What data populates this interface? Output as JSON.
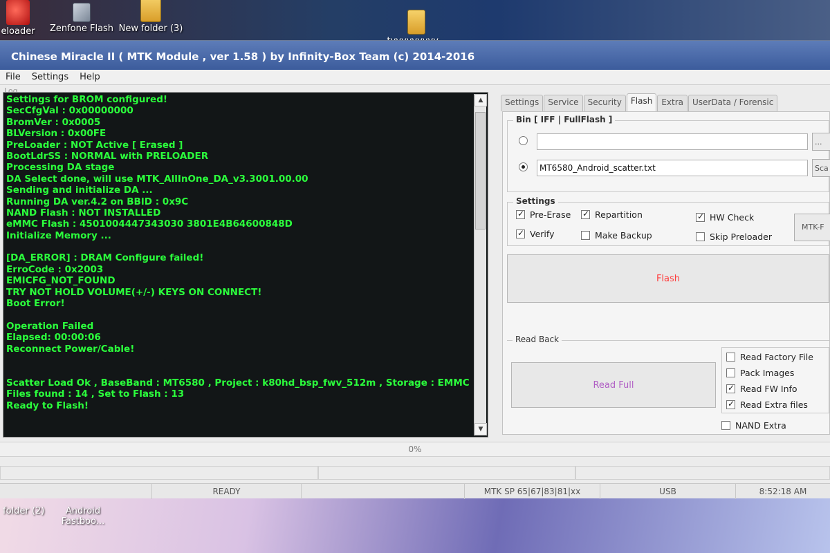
{
  "desktop": {
    "top_icons": [
      {
        "label": "eloader",
        "kind": "red"
      },
      {
        "label": "Zenfone Flash",
        "kind": "app"
      },
      {
        "label": "New folder (3)",
        "kind": "folder"
      },
      {
        "label": "tyyyyyyyyy...",
        "kind": "folder"
      }
    ],
    "bottom_icons": [
      {
        "label": "folder (2)"
      },
      {
        "label": "Android Fastboo..."
      }
    ]
  },
  "window": {
    "title": "Chinese Miracle II ( MTK Module , ver 1.58 ) by Infinity-Box Team (c) 2014-2016",
    "menu": [
      "File",
      "Settings",
      "Help"
    ],
    "log_label": "Log"
  },
  "log": {
    "lines": [
      "Settings for BROM configured!",
      "SecCfgVal : 0x00000000",
      "BromVer   : 0x0005",
      "BLVersion : 0x00FE",
      "PreLoader : NOT Active [ Erased ]",
      "BootLdrSS : NORMAL with PRELOADER",
      "Processing DA stage",
      "DA Select done, will use MTK_AllInOne_DA_v3.3001.00.00",
      "Sending and initialize DA ...",
      "Running DA ver.4.2 on BBID : 0x9C",
      "NAND Flash : NOT INSTALLED",
      "eMMC Flash : 4501004447343030 3801E4B64600848D",
      "Initialize Memory ...",
      "",
      "[DA_ERROR] : DRAM Configure failed!",
      "ErroCode : 0x2003",
      "EMICFG_NOT_FOUND",
      "TRY NOT HOLD VOLUME(+/-) KEYS ON CONNECT!",
      "Boot Error!",
      "",
      "Operation Failed",
      "Elapsed: 00:00:06",
      "Reconnect Power/Cable!",
      "",
      "",
      "Scatter Load Ok , BaseBand : MT6580 , Project : k80hd_bsp_fwv_512m , Storage : EMMC",
      "Files found : 14 , Set to Flash : 13",
      "Ready to Flash!"
    ]
  },
  "tabs": [
    "Settings",
    "Service",
    "Security",
    "Flash",
    "Extra",
    "UserData / Forensic"
  ],
  "active_tab": "Flash",
  "bin": {
    "title": "Bin  [ IFF | FullFlash ]",
    "path1": "",
    "path2": "MT6580_Android_scatter.txt",
    "button1": "...",
    "button2": "Sca"
  },
  "settings": {
    "title": "Settings",
    "pre_erase": "Pre-Erase",
    "repartition": "Repartition",
    "hw_check": "HW Check",
    "verify": "Verify",
    "make_backup": "Make Backup",
    "skip_preloader": "Skip Preloader",
    "mtk_button": "MTK-F"
  },
  "flash_button": "Flash",
  "read_back": {
    "title": "Read Back",
    "read_full": "Read Full",
    "read_factory": "Read Factory File",
    "pack_images": "Pack Images",
    "read_fw_info": "Read FW Info",
    "read_extra": "Read Extra files",
    "nand_extra": "NAND Extra"
  },
  "progress": "0%",
  "status": {
    "state": "READY",
    "protocol": "MTK SP 65|67|83|81|xx",
    "port": "USB",
    "time": "8:52:18 AM"
  },
  "colors": {
    "log_text": "#2bff3c",
    "log_bg": "#121617",
    "flash_text": "#ff3b3b",
    "read_full_text": "#b05fc4"
  }
}
